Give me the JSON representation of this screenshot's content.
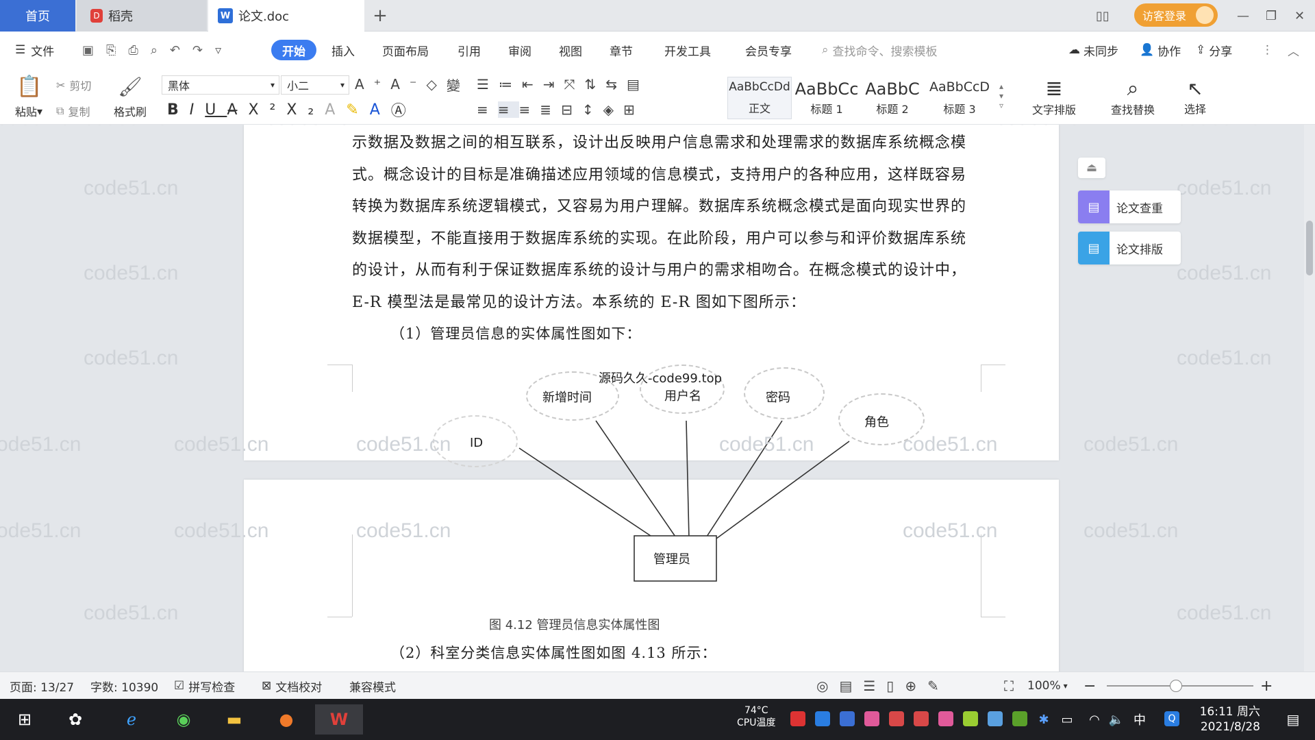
{
  "tabs": {
    "home": "首页",
    "daoke": "稻壳",
    "doc": "论文.doc",
    "new_tab": "+"
  },
  "title_right": {
    "login": "访客登录"
  },
  "menu": {
    "file": "文件",
    "items": [
      "开始",
      "插入",
      "页面布局",
      "引用",
      "审阅",
      "视图",
      "章节",
      "开发工具",
      "会员专享"
    ],
    "search_placeholder": "查找命令、搜索模板",
    "sync": "未同步",
    "collab": "协作",
    "share": "分享"
  },
  "ribbon": {
    "paste": "粘贴",
    "cut": "剪切",
    "copy": "复制",
    "format_painter": "格式刷",
    "font_name": "黑体",
    "font_size": "小二",
    "styles": [
      {
        "sample": "AaBbCcDd",
        "label": "正文"
      },
      {
        "sample": "AaBbCc",
        "label": "标题 1"
      },
      {
        "sample": "AaBbC",
        "label": "标题 2"
      },
      {
        "sample": "AaBbCcD",
        "label": "标题 3"
      }
    ],
    "text_layout": "文字排版",
    "find_replace": "查找替换",
    "select": "选择"
  },
  "document": {
    "paragraph": "示数据及数据之间的相互联系，设计出反映用户信息需求和处理需求的数据库系统概念模式。概念设计的目标是准确描述应用领域的信息模式，支持用户的各种应用，这样既容易转换为数据库系统逻辑模式，又容易为用户理解。数据库系统概念模式是面向现实世界的数据模型，不能直接用于数据库系统的实现。在此阶段，用户可以参与和评价数据库系统的设计，从而有利于保证数据库系统的设计与用户的需求相吻合。在概念模式的设计中，E-R 模型法是最常见的设计方法。本系统的 E-R 图如下图所示：",
    "sub1": "（1）管理员信息的实体属性图如下：",
    "diagram": {
      "watermark_label": "源码久久-code99.top",
      "attributes": [
        "新增时间",
        "用户名",
        "密码",
        "角色",
        "ID"
      ],
      "entity": "管理员"
    },
    "caption": "图 4.12  管理员信息实体属性图",
    "sub2": "（2）科室分类信息实体属性图如图 4.13 所示："
  },
  "watermark": "code51.cn",
  "side_panel": {
    "check": "论文查重",
    "format": "论文排版"
  },
  "status": {
    "page": "页面: 13/27",
    "words": "字数: 10390",
    "spell": "拼写检查",
    "proof": "文档校对",
    "compat": "兼容模式",
    "zoom": "100%"
  },
  "taskbar": {
    "temp": "74°C",
    "cpu": "CPU温度",
    "ime": "中",
    "time": "16:11 周六",
    "date": "2021/8/28"
  },
  "colors": {
    "accent": "#3b7cf0",
    "login": "#f0a033",
    "taskbar": "#1d1e22"
  }
}
